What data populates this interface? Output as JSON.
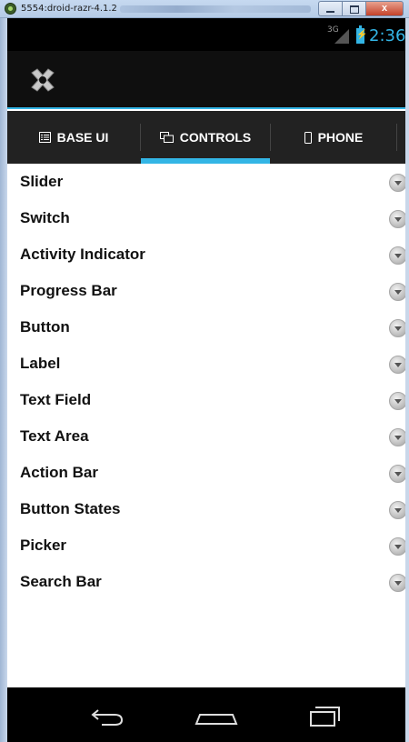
{
  "window": {
    "title": "5554:droid-razr-4.1.2",
    "close_label": "x"
  },
  "status_bar": {
    "network": "3G",
    "time": "2:36"
  },
  "tabs": [
    {
      "label": "BASE UI",
      "icon": "list-icon"
    },
    {
      "label": "CONTROLS",
      "icon": "controls-icon",
      "selected": true
    },
    {
      "label": "PHONE",
      "icon": "phone-icon"
    }
  ],
  "list": {
    "items": [
      {
        "label": "Slider"
      },
      {
        "label": "Switch"
      },
      {
        "label": "Activity Indicator"
      },
      {
        "label": "Progress Bar"
      },
      {
        "label": "Button"
      },
      {
        "label": "Label"
      },
      {
        "label": "Text Field"
      },
      {
        "label": "Text Area"
      },
      {
        "label": "Action Bar"
      },
      {
        "label": "Button States"
      },
      {
        "label": "Picker"
      },
      {
        "label": "Search Bar"
      }
    ]
  },
  "nav_bar": {
    "icons": [
      "back-icon",
      "home-icon",
      "recent-apps-icon"
    ]
  },
  "colors": {
    "accent": "#33b5e5",
    "action_bar": "#0f0f0f",
    "tab_bar": "#222222"
  }
}
